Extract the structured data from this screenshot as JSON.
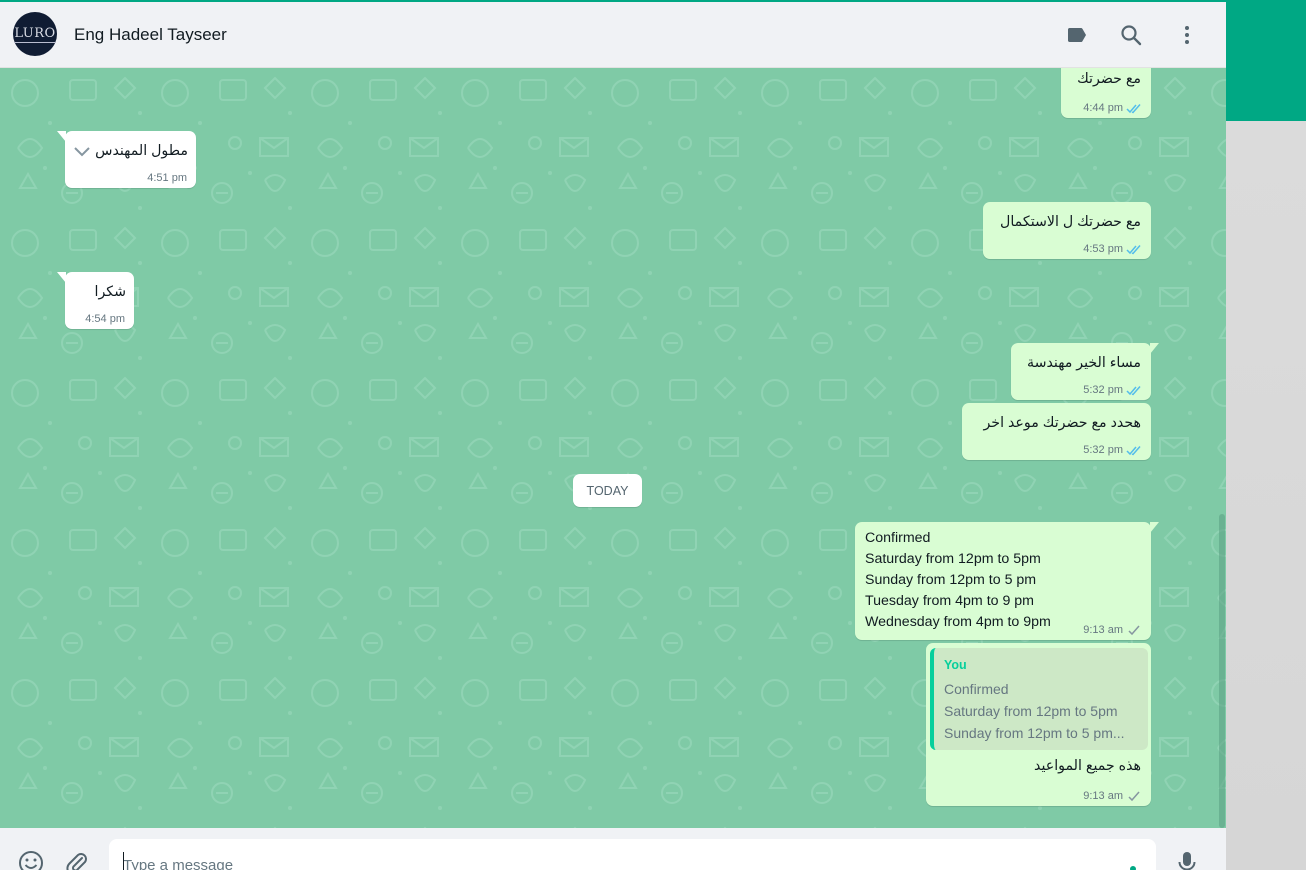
{
  "header": {
    "avatar_text": "LURO",
    "contact_name": "Eng Hadeel Tayseer",
    "icons": [
      "label-icon",
      "search-icon",
      "menu-icon"
    ]
  },
  "colors": {
    "accent": "#00a884",
    "chat_bg": "#7fcaa6",
    "outgoing_bubble": "#d9fdd3",
    "incoming_bubble": "#ffffff",
    "read_tick": "#53bdeb",
    "sent_tick": "#8696a0"
  },
  "messages": [
    {
      "dir": "out",
      "text": "مع حضرتك",
      "time": "4:44 pm",
      "status": "read"
    },
    {
      "dir": "in",
      "text": "مطول المهندس",
      "time": "4:51 pm"
    },
    {
      "dir": "out",
      "text": "مع حضرتك ل الاستكمال",
      "time": "4:53 pm",
      "status": "read"
    },
    {
      "dir": "in",
      "text": "شكرا",
      "time": "4:54 pm"
    },
    {
      "dir": "out",
      "text": "مساء الخير مهندسة",
      "time": "5:32 pm",
      "status": "read"
    },
    {
      "dir": "out",
      "text": "هحدد مع حضرتك موعد اخر",
      "time": "5:32 pm",
      "status": "read"
    },
    {
      "dir": "out",
      "lines": [
        "Confirmed",
        "Saturday from 12pm to 5pm",
        "Sunday from 12pm to 5 pm",
        "Tuesday from 4pm to 9 pm",
        "Wednesday from 4pm to 9pm"
      ],
      "time": "9:13 am",
      "status": "sent"
    },
    {
      "dir": "out",
      "quote": {
        "author": "You",
        "lines": [
          "Confirmed",
          "Saturday from 12pm to 5pm",
          "Sunday from 12pm to 5 pm..."
        ]
      },
      "text": "هذه جميع المواعيد",
      "time": "9:13 am",
      "status": "sent"
    }
  ],
  "date_divider": "TODAY",
  "footer": {
    "placeholder": "Type a message",
    "icons": [
      "emoji-icon",
      "attach-icon",
      "microphone-icon"
    ]
  }
}
